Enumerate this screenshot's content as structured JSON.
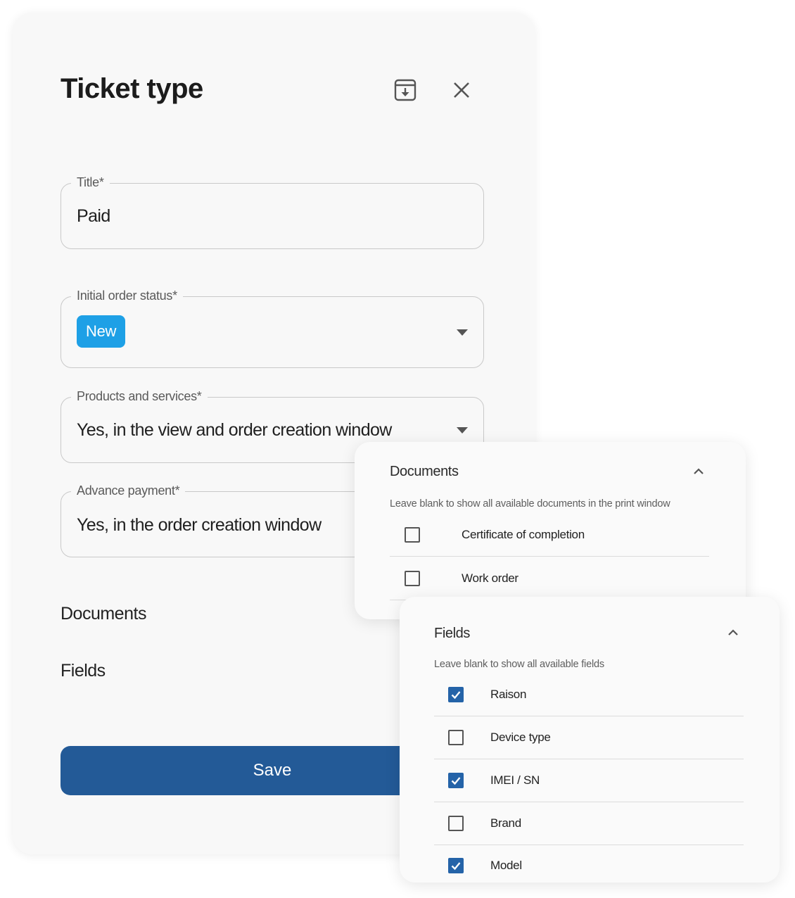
{
  "dialog": {
    "title": "Ticket type",
    "archive_icon": "archive-download-icon",
    "close_icon": "close-icon",
    "fields": {
      "title": {
        "label": "Title",
        "required": "*",
        "value": "Paid"
      },
      "initial_status": {
        "label": "Initial order status",
        "required": "*",
        "value": "New",
        "chip_color": "#1ea0e6"
      },
      "products": {
        "label": "Products and services",
        "required": "*",
        "value": "Yes, in the view and order creation window"
      },
      "advance": {
        "label": "Advance payment",
        "required": "*",
        "value": "Yes, in the order creation window"
      }
    },
    "sections": {
      "documents": "Documents",
      "fields": "Fields"
    },
    "save_label": "Save",
    "save_color": "#235a97"
  },
  "documents_panel": {
    "title": "Documents",
    "hint": "Leave blank to show all available documents in the print window",
    "options": [
      {
        "label": "Certificate of completion",
        "checked": false
      },
      {
        "label": "Work order",
        "checked": false
      }
    ]
  },
  "fields_panel": {
    "title": "Fields",
    "hint": "Leave blank to show all available fields",
    "options": [
      {
        "label": "Raison",
        "checked": true
      },
      {
        "label": "Device type",
        "checked": false
      },
      {
        "label": "IMEI / SN",
        "checked": true
      },
      {
        "label": "Brand",
        "checked": false
      },
      {
        "label": "Model",
        "checked": true
      }
    ]
  }
}
